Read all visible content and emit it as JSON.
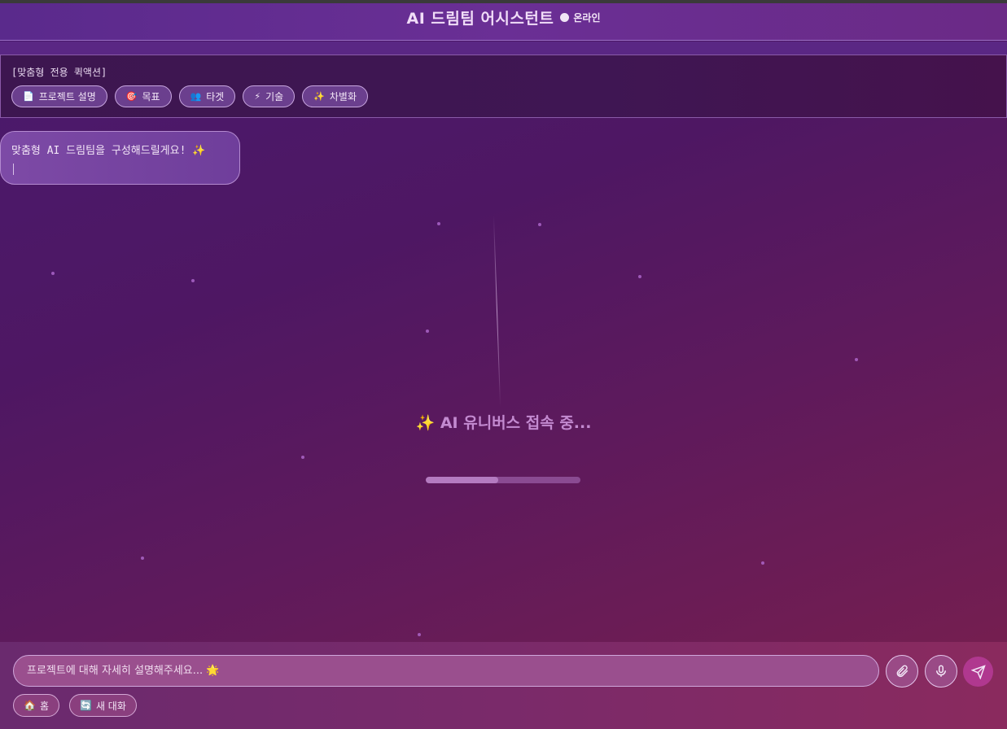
{
  "header": {
    "title": "AI 드림팀 어시스턴트",
    "status": "온라인"
  },
  "quick_actions": {
    "title": "[맞춤형 전용 퀵액션]",
    "items": [
      {
        "icon": "memo-icon",
        "glyph": "📄",
        "label": "프로젝트 설명"
      },
      {
        "icon": "target-icon",
        "glyph": "🎯",
        "label": "목표"
      },
      {
        "icon": "people-icon",
        "glyph": "👥",
        "label": "타겟"
      },
      {
        "icon": "lightning-icon",
        "glyph": "⚡",
        "label": "기술"
      },
      {
        "icon": "sparkles-icon",
        "glyph": "✨",
        "label": "차별화"
      }
    ]
  },
  "chat": {
    "bot_message": "맞춤형 AI 드림팀을 구성해드릴게요! ✨"
  },
  "loading": {
    "text": "✨ AI 유니버스 접속 중...",
    "progress": 0.47
  },
  "composer": {
    "placeholder": "프로젝트에 대해 자세히 설명해주세요... 🌟"
  },
  "footer": {
    "home_label": "홈",
    "home_icon": "home-icon",
    "new_chat_label": "새 대화",
    "new_chat_icon": "refresh-icon"
  }
}
